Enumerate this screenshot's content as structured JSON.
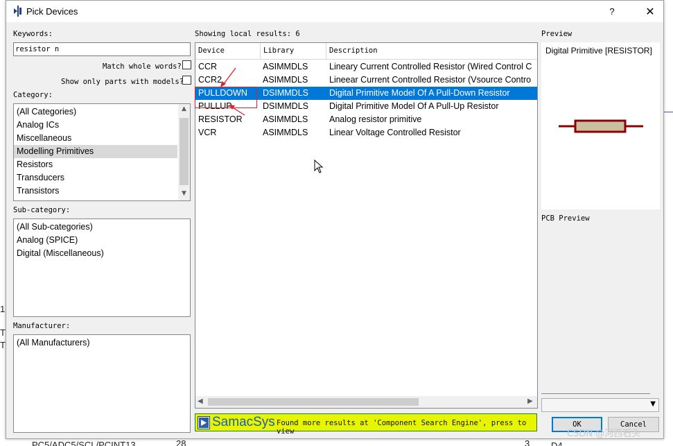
{
  "dialog": {
    "title": "Pick Devices",
    "help": "?",
    "close": "✕"
  },
  "keywords": {
    "label": "Keywords:",
    "value": "resistor n"
  },
  "options": {
    "match_whole_words": "Match whole words?",
    "show_only_models": "Show only parts with models?"
  },
  "category": {
    "label": "Category:",
    "items": [
      "(All Categories)",
      "Analog ICs",
      "Miscellaneous",
      "Modelling Primitives",
      "Resistors",
      "Transducers",
      "Transistors"
    ],
    "selected": "Modelling Primitives"
  },
  "subcategory": {
    "label": "Sub-category:",
    "items": [
      "(All Sub-categories)",
      "Analog (SPICE)",
      "Digital (Miscellaneous)"
    ]
  },
  "manufacturer": {
    "label": "Manufacturer:",
    "items": [
      "(All Manufacturers)"
    ]
  },
  "results": {
    "summary": "Showing local results: 6",
    "columns": [
      "Device",
      "Library",
      "Description"
    ],
    "rows": [
      {
        "device": "CCR",
        "library": "ASIMMDLS",
        "description": "Lineary Current Controlled Resistor (Wired Control C"
      },
      {
        "device": "CCR2",
        "library": "ASIMMDLS",
        "description": "Lineear Current Controlled Resistor (Vsource Contro"
      },
      {
        "device": "PULLDOWN",
        "library": "DSIMMDLS",
        "description": "Digital Primitive Model Of A Pull-Down Resistor"
      },
      {
        "device": "PULLUP",
        "library": "DSIMMDLS",
        "description": "Digital Primitive Model Of A Pull-Up Resistor"
      },
      {
        "device": "RESISTOR",
        "library": "ASIMMDLS",
        "description": "Analog resistor primitive"
      },
      {
        "device": "VCR",
        "library": "ASIMMDLS",
        "description": "Linear Voltage Controlled Resistor"
      }
    ],
    "selected_device": "PULLDOWN"
  },
  "samacsys": {
    "brand": "SamacSys",
    "message": "Found more results at 'Component Search Engine', press to view"
  },
  "preview": {
    "label": "Preview",
    "name": "Digital Primitive [RESISTOR]",
    "pcb_label": "PCB Preview"
  },
  "buttons": {
    "ok": "OK",
    "cancel": "Cancel"
  },
  "watermark": "CSDN @河西石头",
  "background": {
    "left_chars": [
      "1",
      "T",
      "T"
    ],
    "bottom_text": "PC5/ADC5/SCL/PCINT13",
    "num_left": "28",
    "num_right": "3",
    "label_right": "D4"
  },
  "colors": {
    "selection": "#0078d7",
    "annotation": "#e0202a",
    "samacsys_bg": "#e8f500",
    "resistor_body": "#c8c0a0",
    "resistor_stroke": "#8b0000"
  }
}
